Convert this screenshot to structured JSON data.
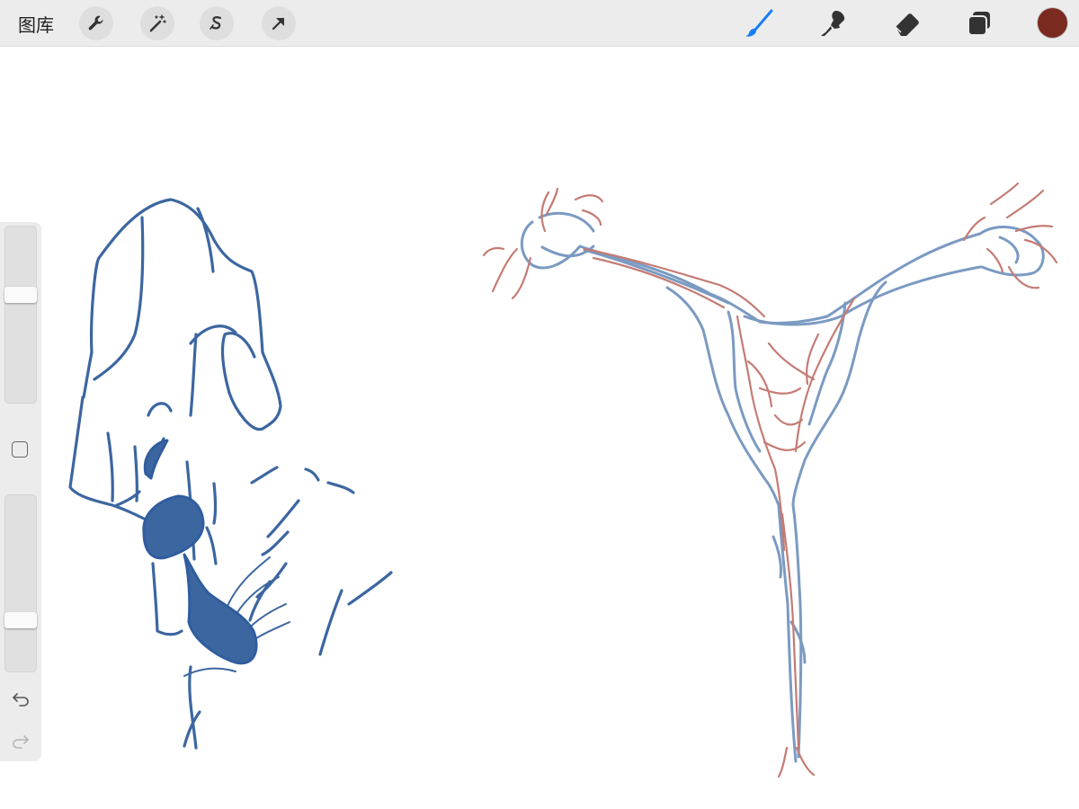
{
  "toolbar": {
    "gallery_label": "图库",
    "left_tools": [
      "wrench-icon",
      "magic-wand-icon",
      "selection-icon",
      "transform-arrow-icon"
    ],
    "right_tools": [
      "paint-brush-icon",
      "smudge-icon",
      "eraser-icon",
      "layers-icon"
    ],
    "active_tool": "paint-brush-icon",
    "active_color": "#7b2a1f",
    "accent_color": "#1a7ef5"
  },
  "sidebar": {
    "brush_size": 0.62,
    "brush_opacity": 0.27,
    "controls": [
      "modify-square-icon",
      "undo-icon",
      "redo-icon"
    ]
  },
  "canvas": {
    "stroke_colors": {
      "blue": "#3c66a0",
      "dark_blue": "#2f5d9e",
      "light_blue": "#7b9ac2",
      "red": "#c47b74"
    }
  }
}
